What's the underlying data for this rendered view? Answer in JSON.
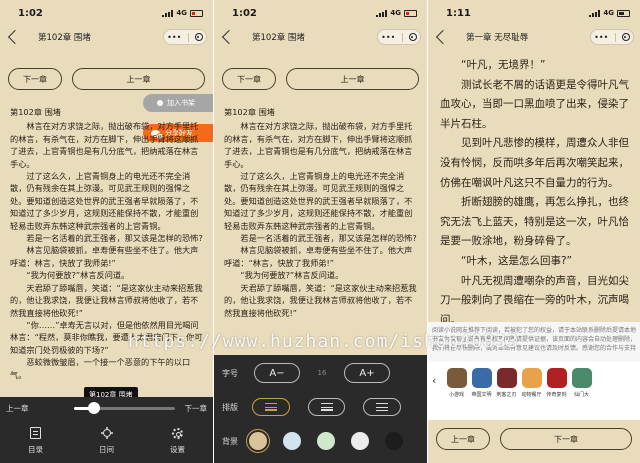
{
  "status": {
    "time1": "1:02",
    "time2": "1:02",
    "time3": "1:11",
    "network": "4G"
  },
  "nav": {
    "title1": "第102章 围堵",
    "title2": "第102章 围堵",
    "title3": "第一章 无尽耻辱",
    "capsule_dots": "•••"
  },
  "chapter_buttons": {
    "prev": "下一章",
    "next": "上一章",
    "bottom_prev": "上一章",
    "bottom_next": "下一章"
  },
  "floating": {
    "add_shelf": "加入书架",
    "share": "分享好友"
  },
  "reader": {
    "chapter_heading": "第102章 围堵",
    "paragraphs": [
      "林言在对方求饶之际，抛出破布袋，对方手里托的林言，有杀气在，对方在脚下，伸出手臂将这顺抓了进去，上官青铜也是有几分底气，把纳戒落在林言手心。",
      "过了这么久，上官青铜身上的电光还不完全消散，仍有残余在其上弥漫。可见武王规则的强悍之处。要知道创造这处世界的武王强者早就陨落了，不知道过了多少岁月，这规则还能保持不散，才能重创轻易击败弄东韩这种武宗强者的上官青铜。",
      "若是一名活着的武王强者，那又该是怎样的恐怖?",
      "林言见脑袋被抓，卓寿便有些坐不住了。他大声呼道：林言，快放了我师弟!”",
      "“我为何要放?”林言反问道。",
      "天君舔了舔嘴唇，笑道：“是这家伙主动来招惹我的，他让我求饶，我便让我林言师叔将他收了，若不然我直接将他砍死!”",
      "“你……”卓寿无言以对，但是他依然用目光喝问林言：“程然，莫非你瞧我，要遭人太君府门下，你可知道宗门处罚极彼的下场?”",
      "恶蛟微微皱眉，一个接一个恶意的下午的以口气。"
    ],
    "paragraphs_p2": [
      "林言在对方求饶之际，抛出破布袋，对方手里托的林言，有杀气在，对方在脚下，伸出手臂将这顺抓了进去，上官青铜也是有几分底气，把纳戒落在林言手心。",
      "过了这么久，上官青铜身上的电光还不完全消散，仍有残余在其上弥漫。可见武王规则的强悍之处。要知道创造这处世界的武王强者早就陨落了，不知道过了多少岁月，这规则还能保持不散，才能重创轻易击败弄东韩这种武宗强者的上官青铜。",
      "若是一名活着的武王强者，那又该是怎样的恐怖?",
      "林言见脑袋被抓，卓寿便有些坐不住了。他大声呼道：“林言，快放了我师弟!”",
      "“我为何要放?”林言反问道。",
      "天君舔了舔嘴唇，笑道：“是这家伙主动来招惹我的，他让我求饶，我便让我林言师叔将他收了，若不然我直接将他砍死!”"
    ],
    "paragraphs_p3": [
      "“叶凡，无境界！”",
      "测试长老不屑的话语更是令得叶凡气血攻心，当即一口黑血喷了出来，侵染了半片石柱。",
      "见到叶凡悲惨的模样，周遭众人非但没有怜悯，反而哄多年后再次嘲笑起来，仿佛在嘲讽叶凡这只不自量力的行为。",
      "折断翅膀的雄鹰，再怎么挣扎，也终究无法飞上蓝天，特别是这一次，叶凡恰是要一败涂地，粉身碎骨了。",
      "“叶木，这是怎么回事?”",
      "叶凡无视周遭嘲杂的声音，目光如尖刀一般刺向了畏缩在一旁的叶木，沉声喝问。"
    ]
  },
  "bottom_bar": {
    "prev_chapter": "上一章",
    "next_chapter": "下一章",
    "progress_pct": 0.2,
    "tooltip": "第102章 围堵",
    "tabs": [
      {
        "label": "目录",
        "icon": "catalog-icon"
      },
      {
        "label": "日间",
        "icon": "sun-icon"
      },
      {
        "label": "设置",
        "icon": "gear-icon"
      }
    ]
  },
  "settings": {
    "font_label": "字号",
    "font_decrease": "A−",
    "font_size": "16",
    "font_increase": "A+",
    "layout_label": "排版",
    "bg_label": "背景",
    "backgrounds": [
      "#d8c39a",
      "#d4e4ef",
      "#cfe8cc",
      "#ececec",
      "#1d1d1d"
    ],
    "selected_layout": 0
  },
  "ad": {
    "text": "阅读小说网友推荐下阅读，若被犯了您的权益，请于本站联系删除后提请本地书友为发现小说书有侵权及问题请提供证据，该页面的内容会自动处理删除，我们将在尽快删除，或对本站有意见建议也请及时反馈。感谢您的合作与支持",
    "apps": [
      {
        "name": "小游戏",
        "color": "#7a5a3a"
      },
      {
        "name": "帝国文明",
        "color": "#3a6aa8"
      },
      {
        "name": "刺客之刃",
        "color": "#7a2a2a"
      },
      {
        "name": "动物餐厅",
        "color": "#e8a24a"
      },
      {
        "name": "传奇复刻",
        "color": "#b02020"
      },
      {
        "name": "仙门大",
        "color": "#4a8a6a"
      }
    ]
  },
  "watermark": "https://www.huzhan.com/ishop40833"
}
